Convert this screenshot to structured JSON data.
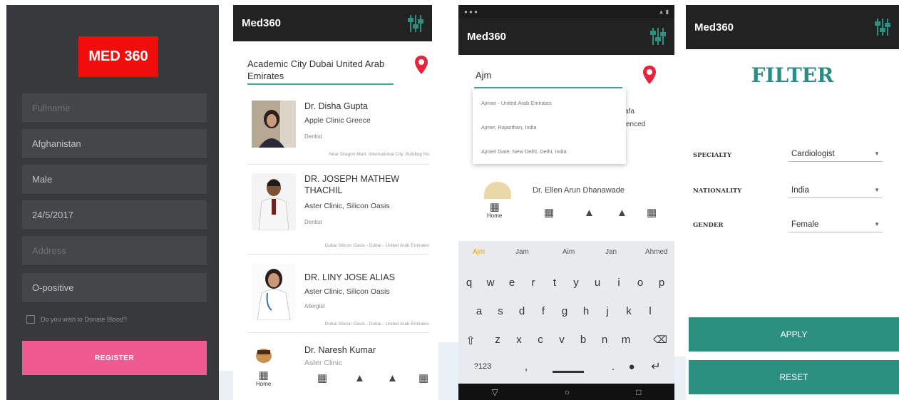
{
  "register_screen": {
    "logo": "MED 360",
    "fields": [
      {
        "value": "Fullname",
        "placeholder": true
      },
      {
        "value": "Afghanistan",
        "placeholder": false
      },
      {
        "value": "Male",
        "placeholder": false
      },
      {
        "value": "24/5/2017",
        "placeholder": false
      },
      {
        "value": "Address",
        "placeholder": true
      },
      {
        "value": "O-positive",
        "placeholder": false
      }
    ],
    "donate_label": "Do you wish to Donate Blood?",
    "register_label": "REGISTER"
  },
  "list_screen": {
    "app_title": "Med360",
    "location": "Academic City Dubai United Arab Emirates",
    "doctors": [
      {
        "name": "Dr. Disha Gupta",
        "clinic": "Apple Clinic Greece",
        "specialty": "Dentist",
        "address": "Near Dragon Mart, International City, Building No"
      },
      {
        "name": "DR. JOSEPH MATHEW THACHIL",
        "clinic": "Aster Clinic, Silicon Oasis",
        "specialty": "Dentist",
        "address": "Dubai Silicon Oasis - Dubai - United Arab Emirates"
      },
      {
        "name": "DR. LINY JOSE ALIAS",
        "clinic": "Aster Clinic, Silicon Oasis",
        "specialty": "Allergist",
        "address": "Dubai Silicon Oasis - Dubai - United Arab Emirates"
      },
      {
        "name": "Dr. Naresh Kumar",
        "clinic": "Aster Clinic",
        "specialty": "",
        "address": ""
      }
    ],
    "nav_home": "Home"
  },
  "search_screen": {
    "app_title": "Med360",
    "search_value": "Ajm",
    "suggestions": [
      "Ajman - United Arab Emirates",
      "Ajmer, Rajasthan, India",
      "Ajmeri Gate, New Delhi, Delhi, India"
    ],
    "peek_text_1": "afa",
    "peek_text_2": "venced",
    "doctor_peek": "Dr. Ellen Arun Dhanawade",
    "nav_home": "Home",
    "keyboard_suggestions": [
      "Ajm",
      "Jam",
      "Aim",
      "Jan",
      "Ahmed"
    ],
    "key_rows": [
      [
        "q",
        "w",
        "e",
        "r",
        "t",
        "y",
        "u",
        "i",
        "o",
        "p"
      ],
      [
        "a",
        "s",
        "d",
        "f",
        "g",
        "h",
        "j",
        "k",
        "l"
      ],
      [
        "z",
        "x",
        "c",
        "v",
        "b",
        "n",
        "m"
      ]
    ],
    "key_numbers": "?123"
  },
  "filter_screen": {
    "app_title": "Med360",
    "title": "FILTER",
    "filters": [
      {
        "label": "SPECIALTY",
        "value": "Cardiologist"
      },
      {
        "label": "NATIONALITY",
        "value": "India"
      },
      {
        "label": "GENDER",
        "value": "Female"
      }
    ],
    "apply_label": "APPLY",
    "reset_label": "RESET"
  },
  "colors": {
    "accent": "#2b9080",
    "logo_red": "#f20d0d",
    "register_pink": "#ef5b8f",
    "pin_red": "#e8243c"
  }
}
